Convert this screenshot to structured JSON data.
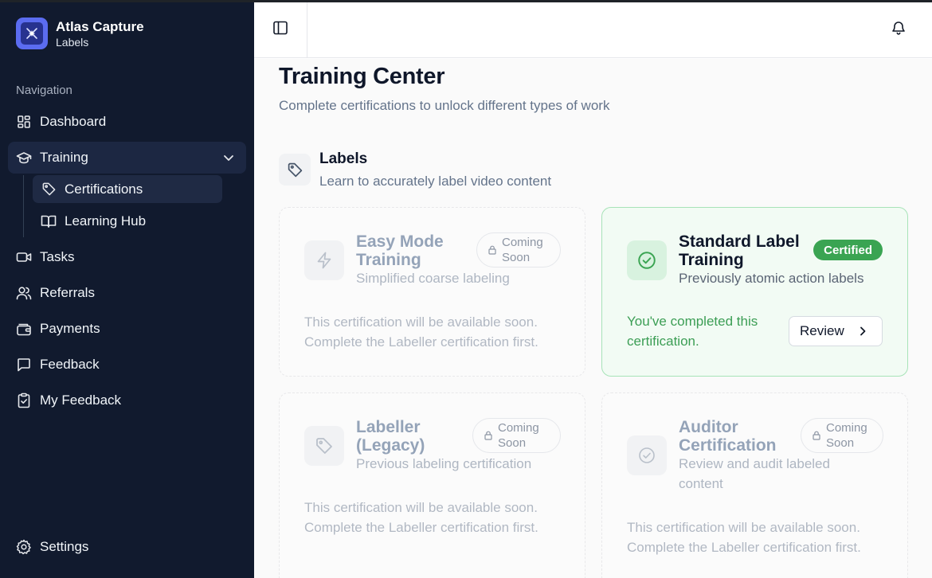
{
  "brand": {
    "title": "Atlas Capture",
    "subtitle": "Labels"
  },
  "sidebar": {
    "heading": "Navigation",
    "items": [
      {
        "label": "Dashboard",
        "icon": "dashboard-icon"
      },
      {
        "label": "Training",
        "icon": "graduation-cap-icon",
        "active": true,
        "expanded": true,
        "children": [
          {
            "label": "Certifications",
            "icon": "tag-icon",
            "active": true
          },
          {
            "label": "Learning Hub",
            "icon": "book-icon"
          }
        ]
      },
      {
        "label": "Tasks",
        "icon": "video-icon"
      },
      {
        "label": "Referrals",
        "icon": "users-icon"
      },
      {
        "label": "Payments",
        "icon": "wallet-icon"
      },
      {
        "label": "Feedback",
        "icon": "message-square-icon"
      },
      {
        "label": "My Feedback",
        "icon": "clipboard-check-icon"
      }
    ],
    "settings": {
      "label": "Settings",
      "icon": "gear-icon"
    }
  },
  "header": {
    "toggle_icon": "sidebar-toggle-icon",
    "bell_icon": "bell-icon"
  },
  "main": {
    "title": "Training Center",
    "subtitle": "Complete certifications to unlock different types of work",
    "section": {
      "title": "Labels",
      "subtitle": "Learn to accurately label video content",
      "icon": "tag-icon"
    },
    "cards": [
      {
        "title": "Easy Mode Training",
        "description": "Simplified coarse labeling",
        "badge": "Coming Soon",
        "icon": "lightning-icon",
        "note": "This certification will be available soon. Complete the Labeller certification first."
      },
      {
        "title": "Standard Label Training",
        "description": "Previously atomic action labels",
        "badge": "Certified",
        "icon": "check-circle-icon",
        "note": "You've completed this certification.",
        "button": "Review"
      },
      {
        "title": "Labeller (Legacy)",
        "description": "Previous labeling certification",
        "badge": "Coming Soon",
        "icon": "tag-icon",
        "note": "This certification will be available soon. Complete the Labeller certification first."
      },
      {
        "title": "Auditor Certification",
        "description": "Review and audit labeled content",
        "badge": "Coming Soon",
        "icon": "check-circle-icon",
        "note": "This certification will be available soon. Complete the Labeller certification first."
      }
    ]
  },
  "colors": {
    "sidebar_bg": "#111a2e",
    "brand_accent": "#5b6cf0",
    "certified_green": "#3aa452",
    "certified_border": "#a7e3b8"
  }
}
